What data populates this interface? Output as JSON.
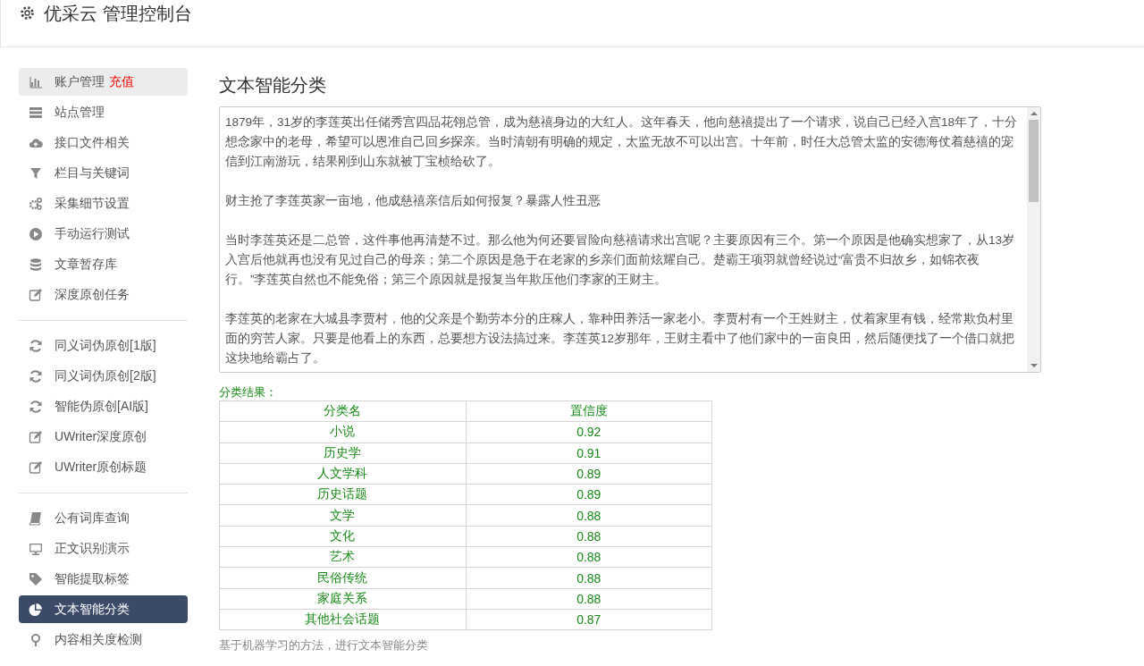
{
  "header": {
    "title": "优采云 管理控制台"
  },
  "sidebar": {
    "groups": [
      {
        "items": [
          {
            "label": "账户管理",
            "badge": "充值",
            "highlighted": true,
            "selected": false
          },
          {
            "label": "站点管理",
            "highlighted": false,
            "selected": false
          },
          {
            "label": "接口文件相关",
            "highlighted": false,
            "selected": false
          },
          {
            "label": "栏目与关键词",
            "highlighted": false,
            "selected": false
          },
          {
            "label": "采集细节设置",
            "highlighted": false,
            "selected": false
          },
          {
            "label": "手动运行测试",
            "highlighted": false,
            "selected": false
          },
          {
            "label": "文章暂存库",
            "highlighted": false,
            "selected": false
          },
          {
            "label": "深度原创任务",
            "highlighted": false,
            "selected": false
          }
        ]
      },
      {
        "items": [
          {
            "label": "同义词伪原创[1版]",
            "highlighted": false,
            "selected": false
          },
          {
            "label": "同义词伪原创[2版]",
            "highlighted": false,
            "selected": false
          },
          {
            "label": "智能伪原创[AI版]",
            "highlighted": false,
            "selected": false
          },
          {
            "label": "UWriter深度原创",
            "highlighted": false,
            "selected": false
          },
          {
            "label": "UWriter原创标题",
            "highlighted": false,
            "selected": false
          }
        ]
      },
      {
        "items": [
          {
            "label": "公有词库查询",
            "highlighted": false,
            "selected": false
          },
          {
            "label": "正文识别演示",
            "highlighted": false,
            "selected": false
          },
          {
            "label": "智能提取标签",
            "highlighted": false,
            "selected": false
          },
          {
            "label": "文本智能分类",
            "highlighted": false,
            "selected": true
          },
          {
            "label": "内容相关度检测",
            "highlighted": false,
            "selected": false
          }
        ]
      }
    ]
  },
  "main": {
    "title": "文本智能分类",
    "text_input": {
      "paragraphs": [
        "1879年，31岁的李莲英出任储秀宫四品花翎总管，成为慈禧身边的大红人。这年春天，他向慈禧提出了一个请求，说自己已经入宫18年了，十分想念家中的老母，希望可以恩准自己回乡探亲。当时清朝有明确的规定，太监无故不可以出宫。十年前，时任大总管太监的安德海仗着慈禧的宠信到江南游玩，结果刚到山东就被丁宝桢给砍了。",
        "财主抢了李莲英家一亩地，他成慈禧亲信后如何报复？暴露人性丑恶",
        "当时李莲英还是二总管，这件事他再清楚不过。那么他为何还要冒险向慈禧请求出宫呢？主要原因有三个。第一个原因是他确实想家了，从13岁入宫后他就再也没有见过自己的母亲；第二个原因是急于在老家的乡亲们面前炫耀自己。楚霸王项羽就曾经说过“富贵不归故乡，如锦衣夜行。”李莲英自然也不能免俗；第三个原因就是报复当年欺压他们李家的王财主。",
        "李莲英的老家在大城县李贾村，他的父亲是个勤劳本分的庄稼人，靠种田养活一家老小。李贾村有一个王姓财主，仗着家里有钱，经常欺负村里面的穷苦人家。只要是他看上的东西，总要想方设法搞过来。李莲英12岁那年，王财主看中了他们家中的一亩良田，然后随便找了一个借口就把这块地给霸占了。"
      ]
    },
    "result_label": "分类结果：",
    "table": {
      "columns": [
        "分类名",
        "置信度"
      ],
      "rows": [
        [
          "小说",
          "0.92"
        ],
        [
          "历史学",
          "0.91"
        ],
        [
          "人文学科",
          "0.89"
        ],
        [
          "历史话题",
          "0.89"
        ],
        [
          "文学",
          "0.88"
        ],
        [
          "文化",
          "0.88"
        ],
        [
          "艺术",
          "0.88"
        ],
        [
          "民俗传统",
          "0.88"
        ],
        [
          "家庭关系",
          "0.88"
        ],
        [
          "其他社会话题",
          "0.87"
        ]
      ]
    },
    "footer_note": "基于机器学习的方法，进行文本智能分类"
  }
}
